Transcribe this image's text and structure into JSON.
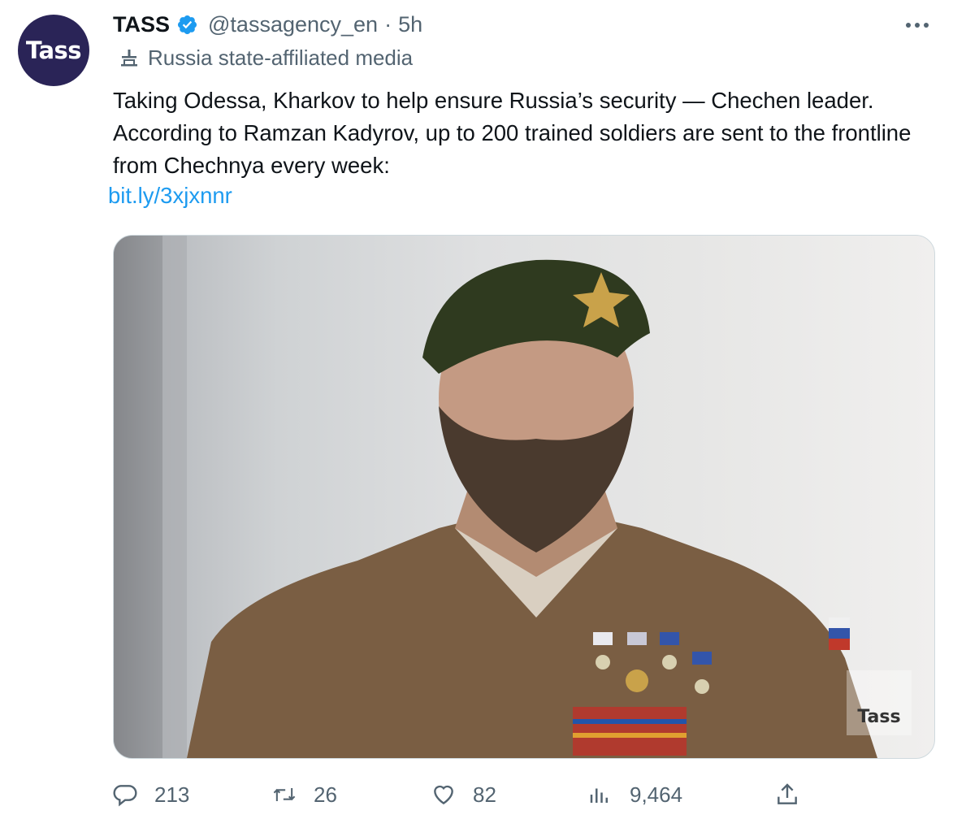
{
  "account": {
    "avatar_text": "Tass",
    "name": "TASS",
    "handle": "@tassagency_en",
    "separator": "·",
    "time": "5h",
    "label": "Russia state-affiliated media"
  },
  "tweet": {
    "text": "Taking Odessa, Kharkov to help ensure Russia’s security — Chechen leader. According to Ramzan Kadyrov, up to 200 trained soldiers are sent to the frontline from Chechnya every week:",
    "link": "bit.ly/3xjxnnr",
    "media_watermark": "Tass"
  },
  "metrics": {
    "replies": "213",
    "retweets": "26",
    "likes": "82",
    "views": "9,464"
  },
  "colors": {
    "accent": "#1d9bf0",
    "muted": "#536471",
    "avatar_bg": "#2a2457"
  },
  "icons": [
    "verified-badge-icon",
    "more-icon",
    "state-media-icon",
    "reply-icon",
    "retweet-icon",
    "like-icon",
    "views-icon",
    "share-icon"
  ]
}
